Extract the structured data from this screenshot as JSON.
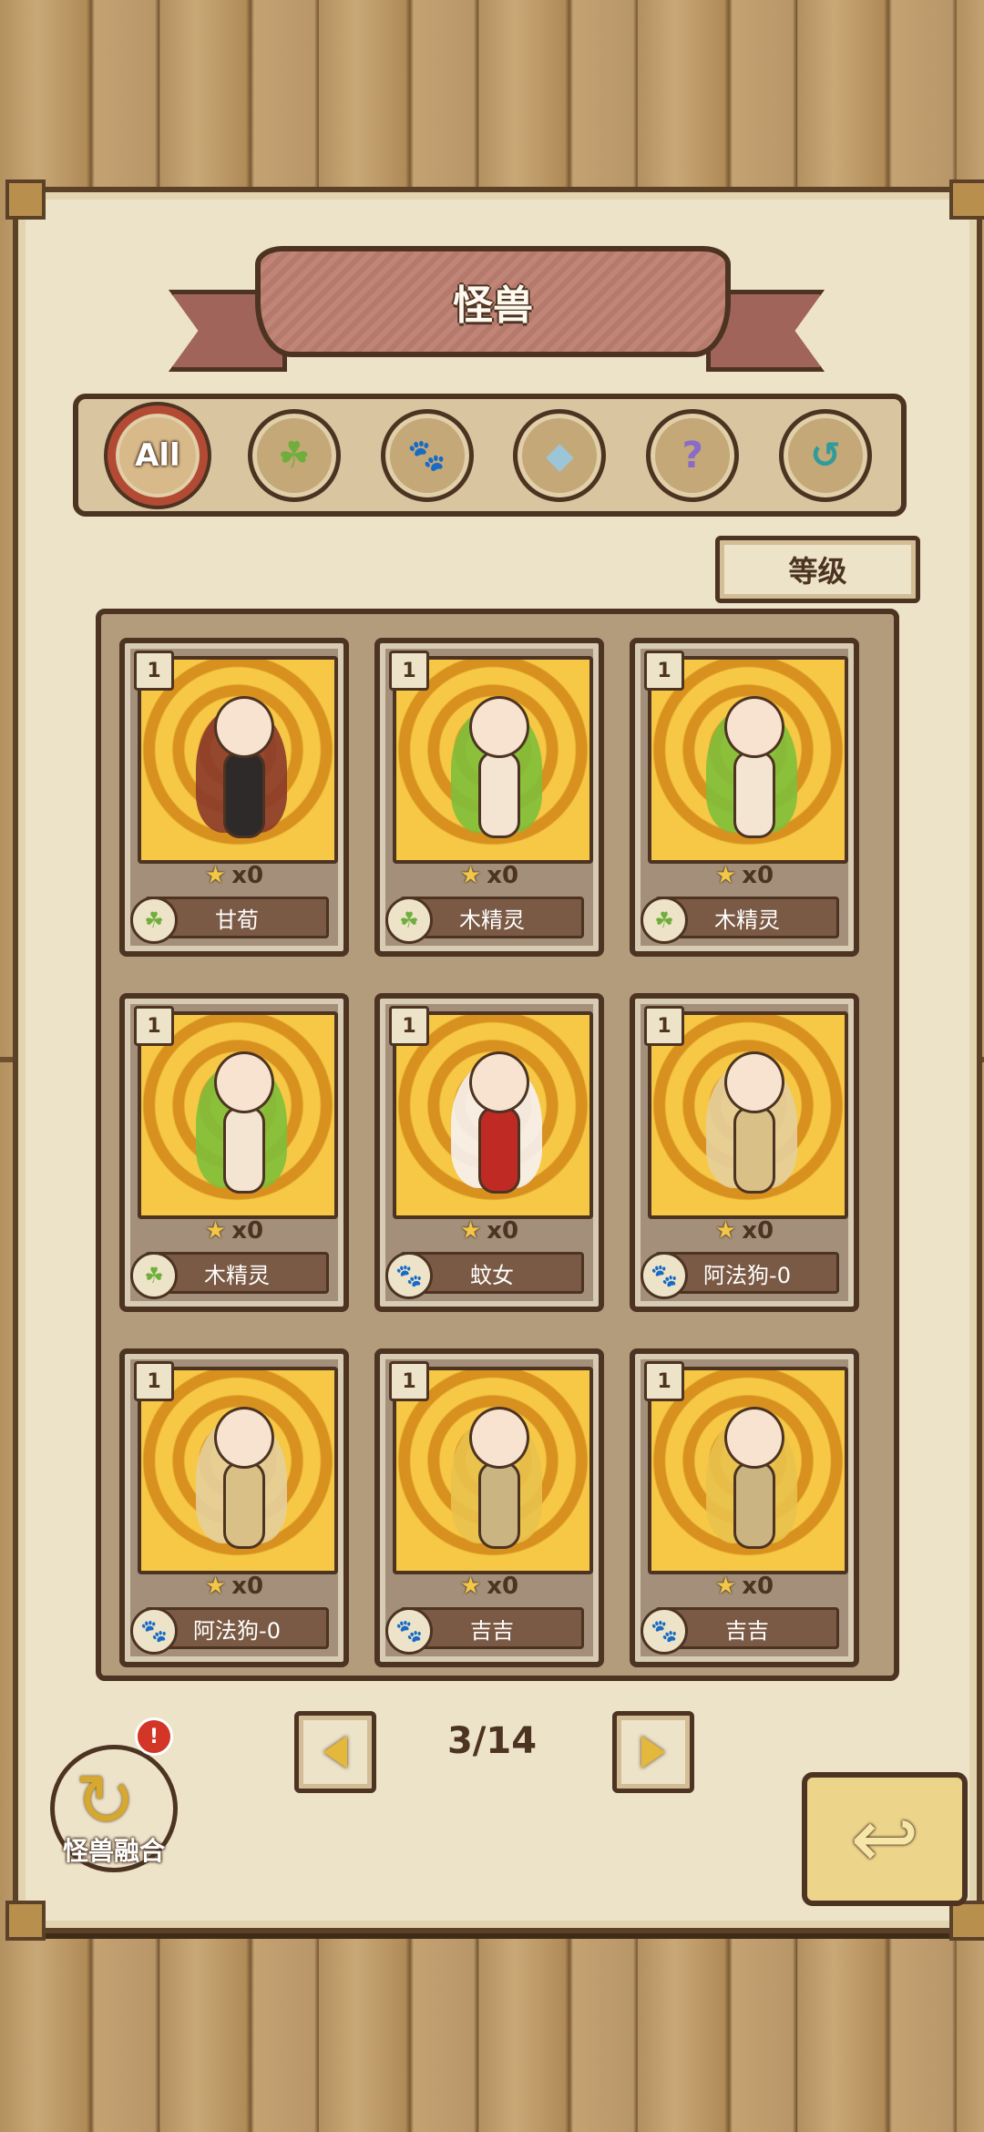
{
  "title": "怪兽",
  "filters": [
    {
      "label": "All",
      "icon": "all-icon",
      "active": true
    },
    {
      "label": "",
      "icon": "leaf-icon",
      "glyph": "☘"
    },
    {
      "label": "",
      "icon": "paw-icon",
      "glyph": "🐾"
    },
    {
      "label": "",
      "icon": "crystal-icon",
      "glyph": "◆"
    },
    {
      "label": "",
      "icon": "question-icon",
      "glyph": "?"
    },
    {
      "label": "",
      "icon": "swirl-icon",
      "glyph": "↺"
    }
  ],
  "sort_label": "等级",
  "cards": [
    {
      "level": "1",
      "count": "x0",
      "name": "甘荀",
      "type_icon": "leaf-icon",
      "type_glyph": "☘",
      "hair": "#8b3a2a",
      "body": "#2e2a2a"
    },
    {
      "level": "1",
      "count": "x0",
      "name": "木精灵",
      "type_icon": "leaf-icon",
      "type_glyph": "☘",
      "hair": "#7fbf3a",
      "body": "#f4e4d2"
    },
    {
      "level": "1",
      "count": "x0",
      "name": "木精灵",
      "type_icon": "leaf-icon",
      "type_glyph": "☘",
      "hair": "#7fbf3a",
      "body": "#f4e4d2"
    },
    {
      "level": "1",
      "count": "x0",
      "name": "木精灵",
      "type_icon": "leaf-icon",
      "type_glyph": "☘",
      "hair": "#7fbf3a",
      "body": "#f4e4d2"
    },
    {
      "level": "1",
      "count": "x0",
      "name": "蚊女",
      "type_icon": "paw-icon",
      "type_glyph": "🐾",
      "hair": "#f7f2f2",
      "body": "#c02a24"
    },
    {
      "level": "1",
      "count": "x0",
      "name": "阿法狗-0",
      "type_icon": "paw-icon",
      "type_glyph": "🐾",
      "hair": "#e6cf9c",
      "body": "#d9c086"
    },
    {
      "level": "1",
      "count": "x0",
      "name": "阿法狗-0",
      "type_icon": "paw-icon",
      "type_glyph": "🐾",
      "hair": "#e6cf9c",
      "body": "#d9c086"
    },
    {
      "level": "1",
      "count": "x0",
      "name": "吉吉",
      "type_icon": "paw-icon",
      "type_glyph": "🐾",
      "hair": "#e9c24d",
      "body": "#c9b482"
    },
    {
      "level": "1",
      "count": "x0",
      "name": "吉吉",
      "type_icon": "paw-icon",
      "type_glyph": "🐾",
      "hair": "#e9c24d",
      "body": "#c9b482"
    }
  ],
  "pager": {
    "current": "3/14"
  },
  "fusion": {
    "label": "怪兽融合",
    "badge": "!"
  },
  "colors": {
    "border": "#4c3322",
    "parchment": "#ede3c8",
    "card_art": "#f6c845",
    "active_ring": "#b34a33"
  }
}
